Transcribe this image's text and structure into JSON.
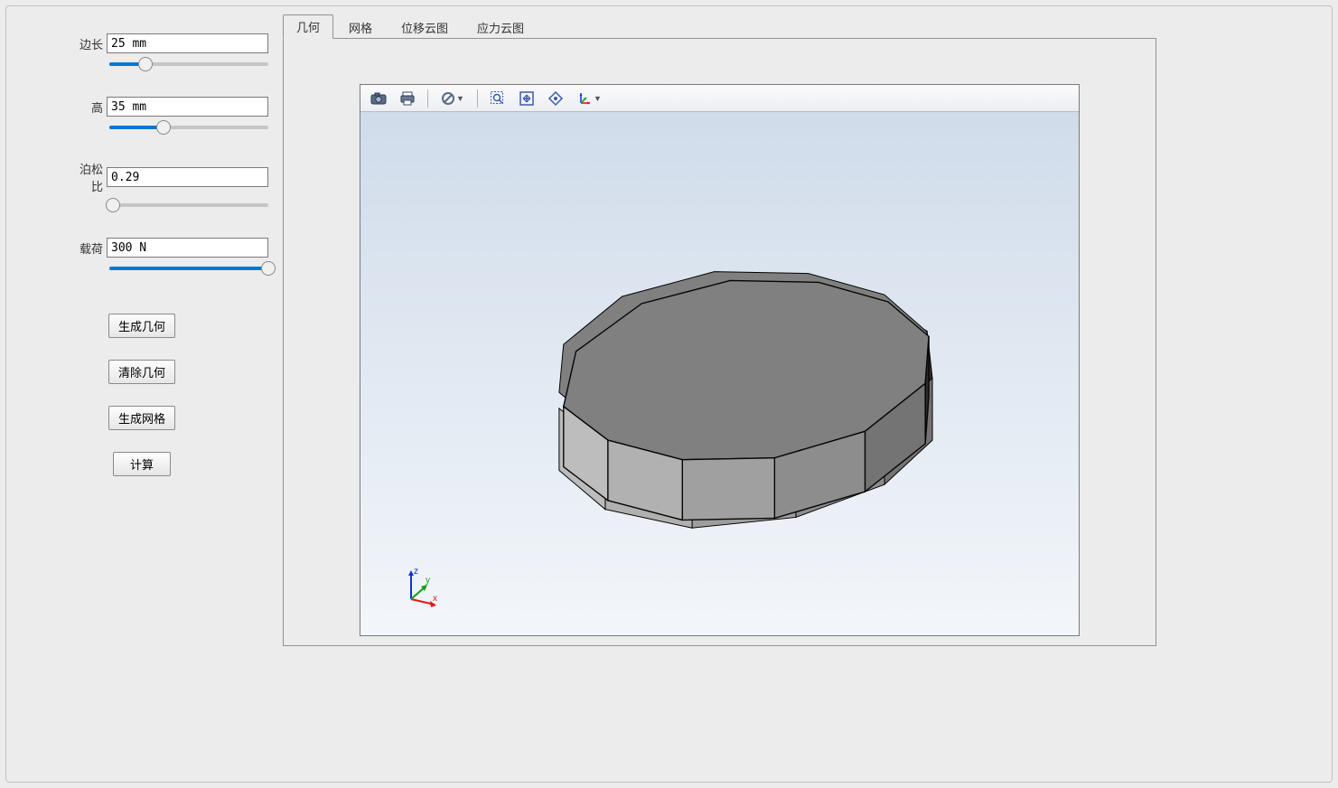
{
  "params": {
    "edge": {
      "label": "边长",
      "value": "25 mm",
      "percent": 23
    },
    "height": {
      "label": "高",
      "value": "35 mm",
      "percent": 34
    },
    "poisson": {
      "label": "泊松比",
      "value": "0.29",
      "percent": 2
    },
    "load": {
      "label": "载荷",
      "value": "300 N",
      "percent": 100
    }
  },
  "buttons": {
    "gen_geom": "生成几何",
    "clear_geom": "清除几何",
    "gen_mesh": "生成网格",
    "calc": "  计算  "
  },
  "tabs": {
    "geom": "几何",
    "mesh": "网格",
    "disp": "位移云图",
    "stress": "应力云图"
  },
  "triad": {
    "x": "x",
    "y": "y",
    "z": "z"
  }
}
